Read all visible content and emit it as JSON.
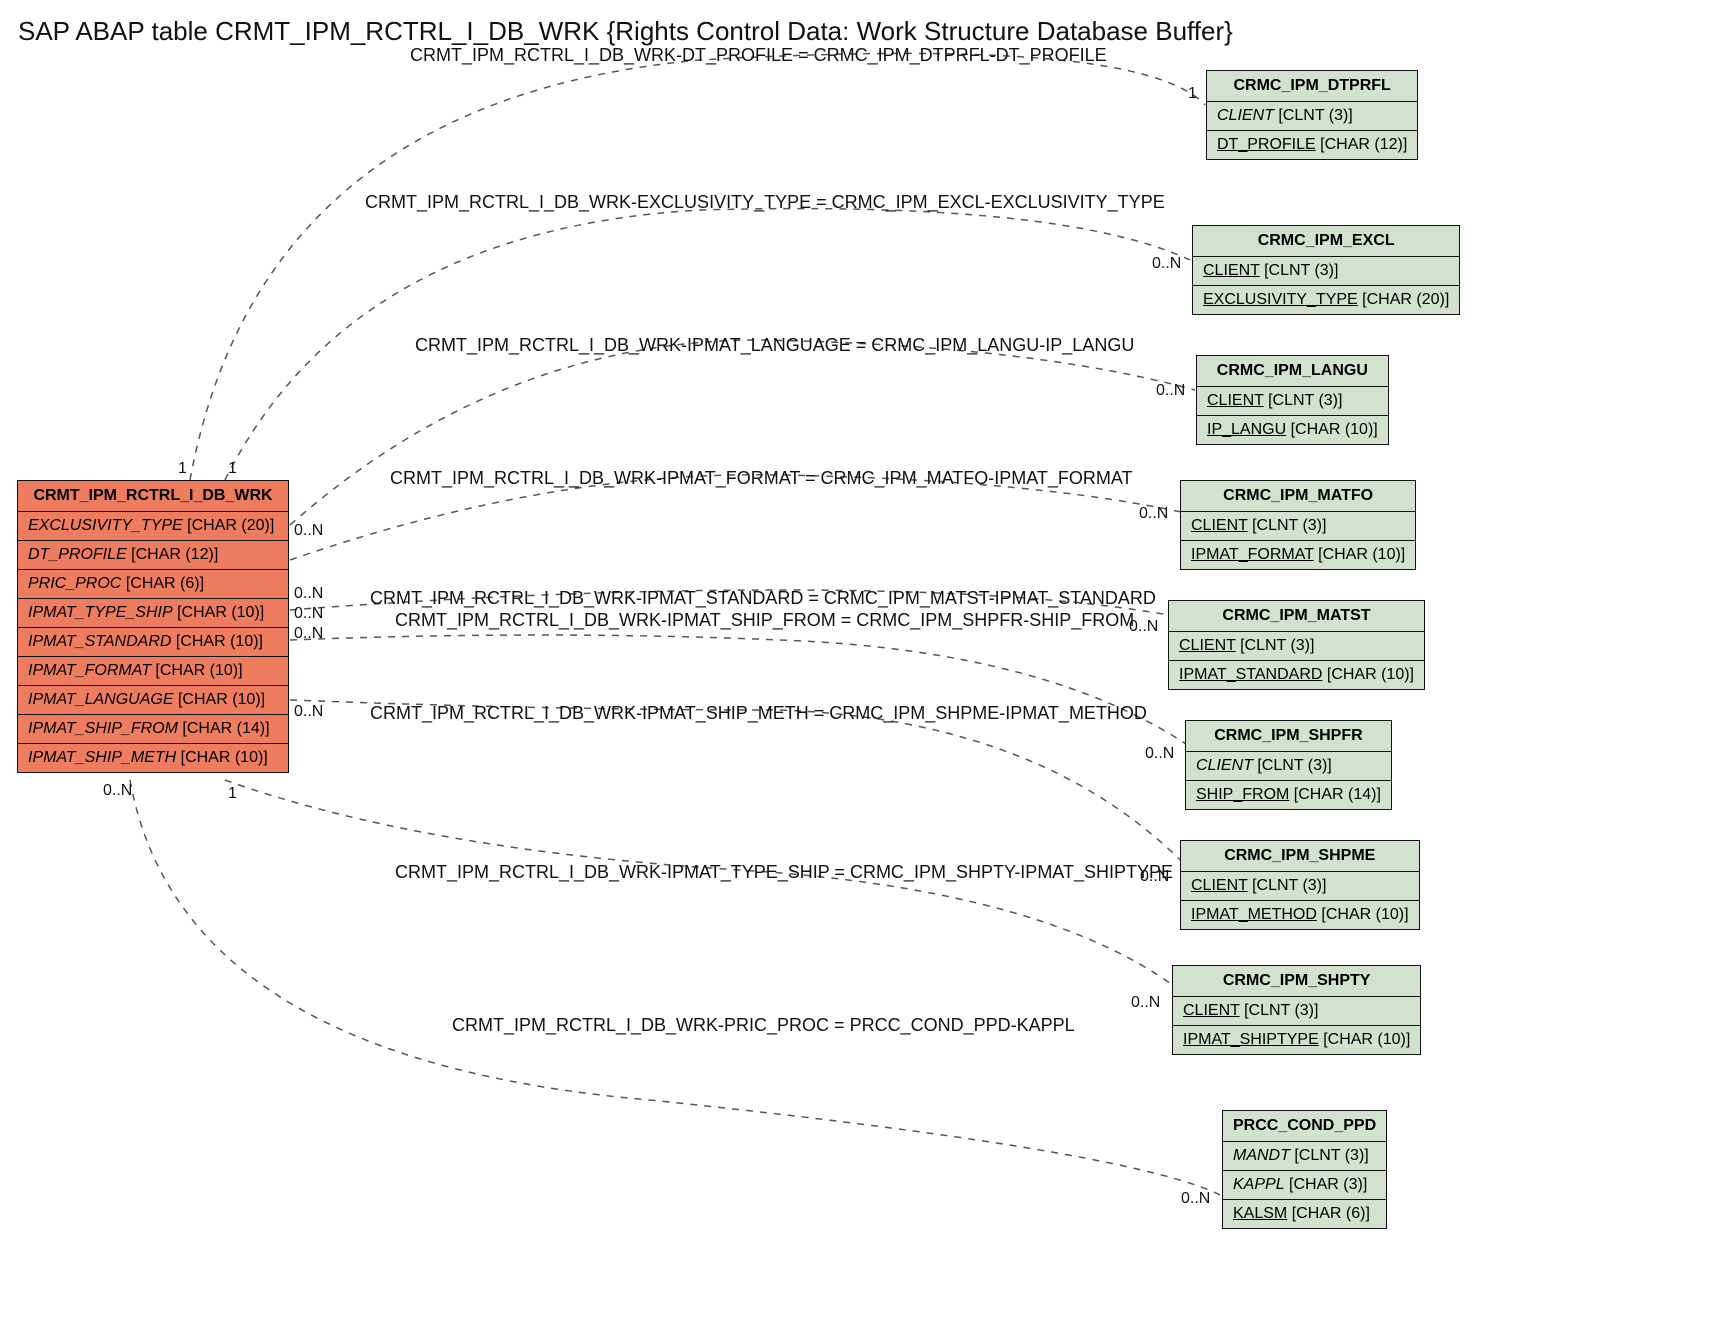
{
  "title": "SAP ABAP table CRMT_IPM_RCTRL_I_DB_WRK {Rights Control Data: Work Structure Database Buffer}",
  "main": {
    "name": "CRMT_IPM_RCTRL_I_DB_WRK",
    "fields": [
      {
        "name": "EXCLUSIVITY_TYPE",
        "type": "[CHAR (20)]"
      },
      {
        "name": "DT_PROFILE",
        "type": "[CHAR (12)]"
      },
      {
        "name": "PRIC_PROC",
        "type": "[CHAR (6)]"
      },
      {
        "name": "IPMAT_TYPE_SHIP",
        "type": "[CHAR (10)]"
      },
      {
        "name": "IPMAT_STANDARD",
        "type": "[CHAR (10)]"
      },
      {
        "name": "IPMAT_FORMAT",
        "type": "[CHAR (10)]"
      },
      {
        "name": "IPMAT_LANGUAGE",
        "type": "[CHAR (10)]"
      },
      {
        "name": "IPMAT_SHIP_FROM",
        "type": "[CHAR (14)]"
      },
      {
        "name": "IPMAT_SHIP_METH",
        "type": "[CHAR (10)]"
      }
    ]
  },
  "refs": {
    "dtprfl": {
      "name": "CRMC_IPM_DTPRFL",
      "f1": {
        "name": "CLIENT",
        "type": "[CLNT (3)]",
        "ul": false
      },
      "f2": {
        "name": "DT_PROFILE",
        "type": "[CHAR (12)]",
        "ul": true
      }
    },
    "excl": {
      "name": "CRMC_IPM_EXCL",
      "f1": {
        "name": "CLIENT",
        "type": "[CLNT (3)]",
        "ul": true
      },
      "f2": {
        "name": "EXCLUSIVITY_TYPE",
        "type": "[CHAR (20)]",
        "ul": true
      }
    },
    "langu": {
      "name": "CRMC_IPM_LANGU",
      "f1": {
        "name": "CLIENT",
        "type": "[CLNT (3)]",
        "ul": true
      },
      "f2": {
        "name": "IP_LANGU",
        "type": "[CHAR (10)]",
        "ul": true
      }
    },
    "matfo": {
      "name": "CRMC_IPM_MATFO",
      "f1": {
        "name": "CLIENT",
        "type": "[CLNT (3)]",
        "ul": true
      },
      "f2": {
        "name": "IPMAT_FORMAT",
        "type": "[CHAR (10)]",
        "ul": true
      }
    },
    "matst": {
      "name": "CRMC_IPM_MATST",
      "f1": {
        "name": "CLIENT",
        "type": "[CLNT (3)]",
        "ul": true
      },
      "f2": {
        "name": "IPMAT_STANDARD",
        "type": "[CHAR (10)]",
        "ul": true
      }
    },
    "shpfr": {
      "name": "CRMC_IPM_SHPFR",
      "f1": {
        "name": "CLIENT",
        "type": "[CLNT (3)]",
        "ul": false
      },
      "f2": {
        "name": "SHIP_FROM",
        "type": "[CHAR (14)]",
        "ul": true
      }
    },
    "shpme": {
      "name": "CRMC_IPM_SHPME",
      "f1": {
        "name": "CLIENT",
        "type": "[CLNT (3)]",
        "ul": true
      },
      "f2": {
        "name": "IPMAT_METHOD",
        "type": "[CHAR (10)]",
        "ul": true
      }
    },
    "shpty": {
      "name": "CRMC_IPM_SHPTY",
      "f1": {
        "name": "CLIENT",
        "type": "[CLNT (3)]",
        "ul": true
      },
      "f2": {
        "name": "IPMAT_SHIPTYPE",
        "type": "[CHAR (10)]",
        "ul": true
      }
    },
    "ppd": {
      "name": "PRCC_COND_PPD",
      "f1": {
        "name": "MANDT",
        "type": "[CLNT (3)]",
        "ul": false
      },
      "f2": {
        "name": "KAPPL",
        "type": "[CHAR (3)]",
        "ul": false
      },
      "f3": {
        "name": "KALSM",
        "type": "[CHAR (6)]",
        "ul": true
      }
    }
  },
  "rels": {
    "r1": "CRMT_IPM_RCTRL_I_DB_WRK-DT_PROFILE = CRMC_IPM_DTPRFL-DT_PROFILE",
    "r2": "CRMT_IPM_RCTRL_I_DB_WRK-EXCLUSIVITY_TYPE = CRMC_IPM_EXCL-EXCLUSIVITY_TYPE",
    "r3": "CRMT_IPM_RCTRL_I_DB_WRK-IPMAT_LANGUAGE = CRMC_IPM_LANGU-IP_LANGU",
    "r4": "CRMT_IPM_RCTRL_I_DB_WRK-IPMAT_FORMAT = CRMC_IPM_MATFO-IPMAT_FORMAT",
    "r5": "CRMT_IPM_RCTRL_I_DB_WRK-IPMAT_STANDARD = CRMC_IPM_MATST-IPMAT_STANDARD",
    "r6": "CRMT_IPM_RCTRL_I_DB_WRK-IPMAT_SHIP_FROM = CRMC_IPM_SHPFR-SHIP_FROM",
    "r7": "CRMT_IPM_RCTRL_I_DB_WRK-IPMAT_SHIP_METH = CRMC_IPM_SHPME-IPMAT_METHOD",
    "r8": "CRMT_IPM_RCTRL_I_DB_WRK-IPMAT_TYPE_SHIP = CRMC_IPM_SHPTY-IPMAT_SHIPTYPE",
    "r9": "CRMT_IPM_RCTRL_I_DB_WRK-PRIC_PROC = PRCC_COND_PPD-KAPPL"
  },
  "cards": {
    "one": "1",
    "zn": "0..N"
  }
}
